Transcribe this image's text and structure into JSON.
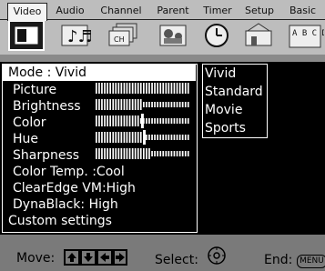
{
  "tabs": [
    "Video",
    "Audio",
    "Channel",
    "Parent",
    "Timer",
    "Setup",
    "Basic"
  ],
  "active_tab": 0,
  "icons": [
    "video-icon",
    "audio-icon",
    "channel-icon",
    "parent-icon",
    "timer-icon",
    "setup-icon",
    "basic-icon"
  ],
  "channel_icon_text": "CH",
  "basic_icon_text": "A B C D",
  "video_menu": {
    "mode": "Mode : Vivid",
    "picture": "Picture",
    "brightness": "Brightness",
    "color": "Color",
    "hue": "Hue",
    "sharpness": "Sharpness",
    "color_temp": "Color Temp. :Cool",
    "clearedge": "ClearEdge VM:High",
    "dynablack": "DynaBlack: High",
    "custom": "Custom settings"
  },
  "levels": {
    "picture": 1.0,
    "brightness": 0.5,
    "color": 0.48,
    "hue": 0.5,
    "sharpness": 0.6
  },
  "mode_options": [
    "Vivid",
    "Standard",
    "Movie",
    "Sports"
  ],
  "footer": {
    "move_label": "Move:",
    "select_label": "Select:",
    "end_label": "End:",
    "menu_key": "MENU"
  },
  "colors": {
    "panel_bg": "#000000",
    "highlight": "#ffffff",
    "screen_bg": "#7a7a7a"
  }
}
